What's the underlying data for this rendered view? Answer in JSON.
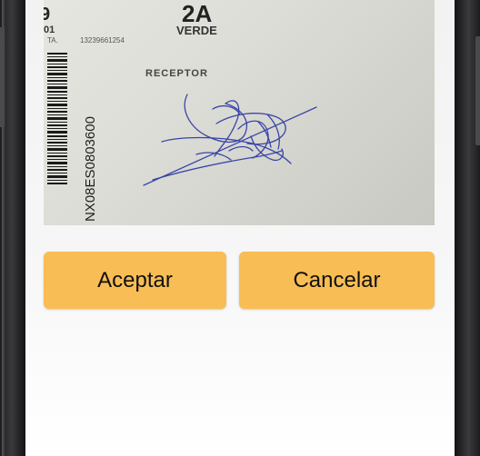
{
  "photo": {
    "top_number": "2A",
    "top_color": "VERDE",
    "left_code": "01",
    "ref_prefix": "TA.",
    "ref_number": "13239661254",
    "receptor_label": "RECEPTOR",
    "barcode_text": "NX08ES0803600"
  },
  "actions": {
    "accept_label": "Aceptar",
    "cancel_label": "Cancelar"
  },
  "colors": {
    "button_bg": "#f8bd55",
    "signature_ink": "#3a45a8"
  }
}
